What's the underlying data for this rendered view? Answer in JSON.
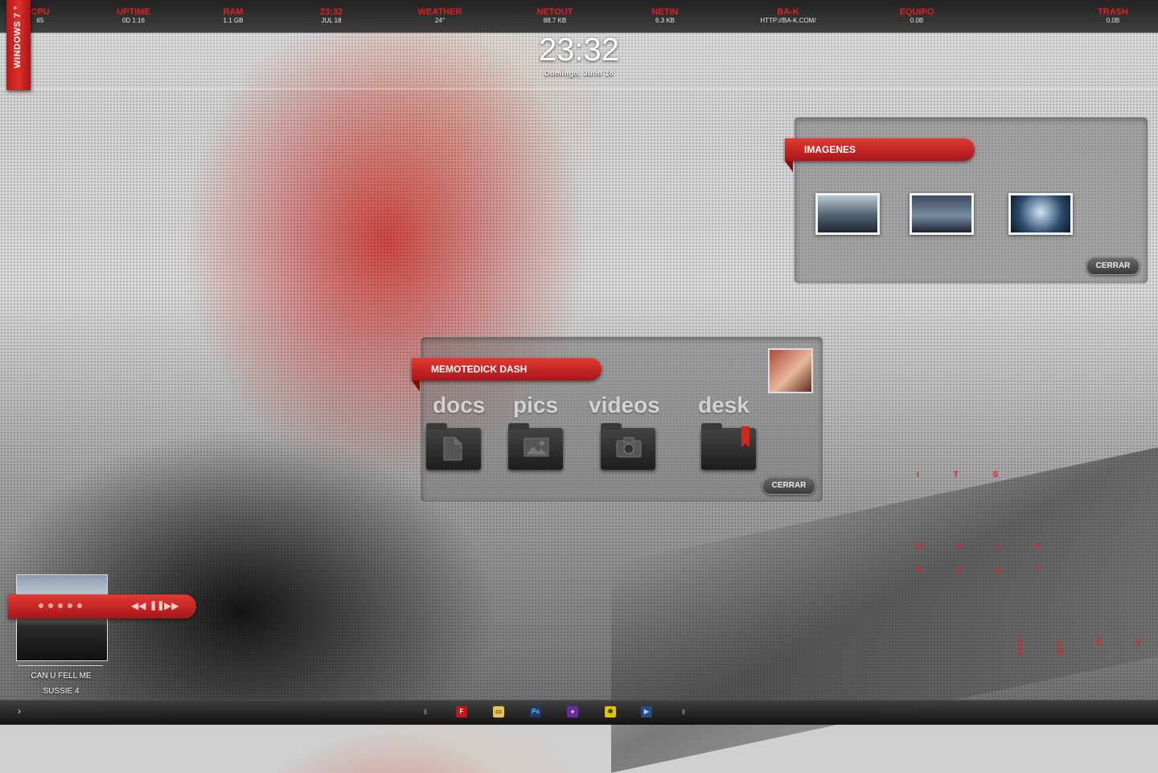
{
  "brand": "WINDOWS 7 °",
  "topbar": [
    {
      "label": "CPU",
      "value": "65"
    },
    {
      "label": "UPTIME",
      "value": "0D 1:16"
    },
    {
      "label": "RAM",
      "value": "1.1 GB"
    },
    {
      "label": "23:32",
      "value": "JUL 18"
    },
    {
      "label": "WEATHER",
      "value": "24°"
    },
    {
      "label": "NETOUT",
      "value": "88.7 KB"
    },
    {
      "label": "NETIN",
      "value": "6.3 KB"
    },
    {
      "label": "BA-K",
      "value": "HTTP://BA-K.COM/"
    },
    {
      "label": "EQUIPO",
      "value": "0.0B"
    },
    {
      "label": "TRASH",
      "value": "0.0B"
    }
  ],
  "clock": {
    "time": "23:32",
    "date": "Domingo, Julio 18"
  },
  "imagenes": {
    "title": "IMAGENES",
    "close": "CERRAR"
  },
  "dash": {
    "title": "MEMOTEDICK DASH",
    "close": "CERRAR",
    "folders": [
      {
        "label": "docs",
        "icon": "document-icon"
      },
      {
        "label": "pics",
        "icon": "image-icon"
      },
      {
        "label": "videos",
        "icon": "camera-icon"
      },
      {
        "label": "desk",
        "icon": "bookmark-icon"
      }
    ]
  },
  "music": {
    "track": "CAN U FELL ME",
    "artist": "SUSSIE 4"
  },
  "word_clock": {
    "line1": "I T S",
    "line2": "H A L F",
    "line3": "P A S T",
    "line4": "E L E V E N"
  },
  "colors": {
    "accent": "#e0201e",
    "ribbon": "#c8221f"
  }
}
